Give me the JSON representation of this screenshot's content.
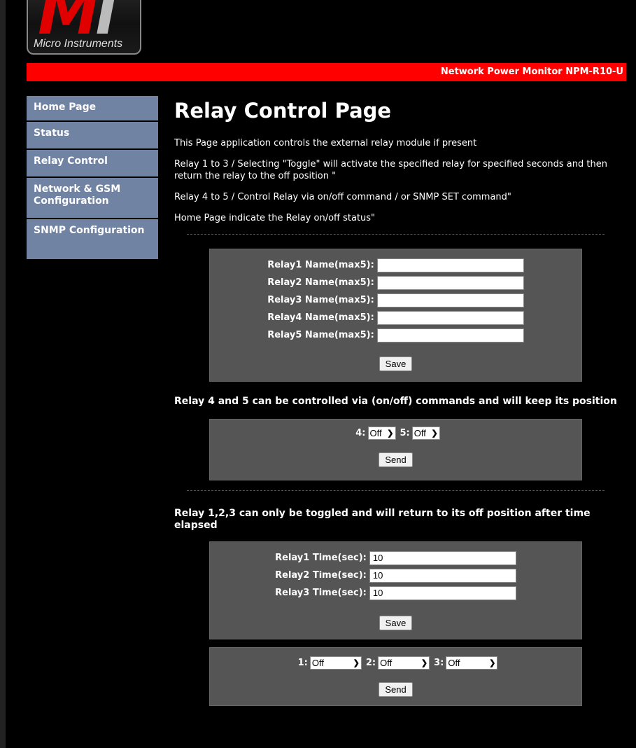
{
  "logo": {
    "mark_m": "M",
    "mark_i": "i",
    "text": "Micro Instruments"
  },
  "header": {
    "title": "Network Power Monitor NPM-R10-U"
  },
  "nav": [
    "Home Page",
    "Status",
    "Relay Control",
    "Network & GSM Configuration",
    "SNMP Configuration"
  ],
  "page": {
    "title": "Relay Control Page",
    "intro": [
      "This Page application controls the external relay module if present",
      "Relay 1 to 3 / Selecting \"Toggle\" will activate the specified relay for specified seconds and then return the relay to the off position \"",
      "Relay 4 to 5 / Control Relay via on/off command / or SNMP SET command\"",
      "Home Page indicate the Relay on/off status\""
    ]
  },
  "names_form": {
    "labels": [
      "Relay1 Name(max5):",
      "Relay2 Name(max5):",
      "Relay3 Name(max5):",
      "Relay4 Name(max5):",
      "Relay5 Name(max5):"
    ],
    "values": [
      "",
      "",
      "",
      "",
      ""
    ],
    "save_label": "Save"
  },
  "onoff_section": {
    "heading": "Relay 4 and 5 can be controlled via (on/off) commands and will keep its position",
    "relay4_label": "4:",
    "relay4_value": "Off",
    "relay5_label": "5:",
    "relay5_value": "Off",
    "send_label": "Send"
  },
  "toggle_section": {
    "heading": "Relay 1,2,3 can only be toggled and will return to its off position after time elapsed",
    "time_labels": [
      "Relay1 Time(sec):",
      "Relay2 Time(sec):",
      "Relay3 Time(sec):"
    ],
    "time_values": [
      "10",
      "10",
      "10"
    ],
    "save_label": "Save",
    "relay1_label": "1:",
    "relay1_value": "Off",
    "relay2_label": "2:",
    "relay2_value": "Off",
    "relay3_label": "3:",
    "relay3_value": "Off",
    "send_label": "Send"
  }
}
